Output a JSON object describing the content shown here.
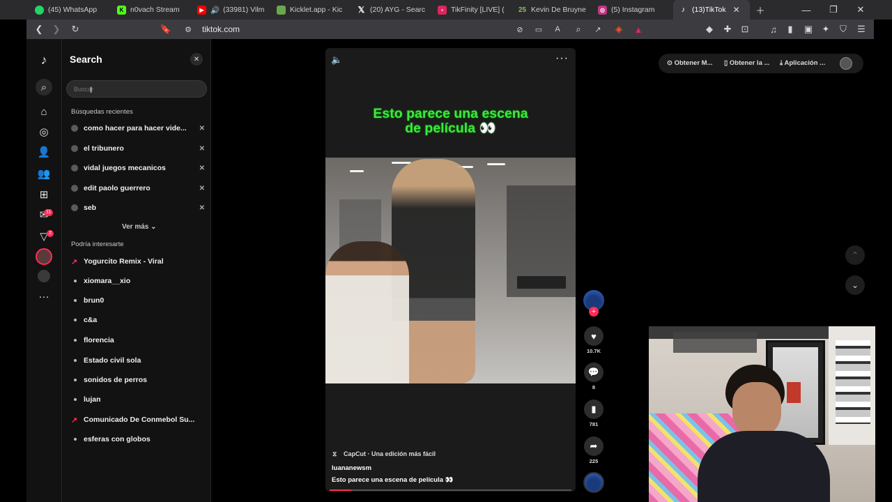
{
  "tabs": [
    {
      "title": "(45) WhatsApp",
      "color": "#25d366"
    },
    {
      "title": "n0vach Stream",
      "color": "#53fc18"
    },
    {
      "title": "(33981) Vilm",
      "color": "#ff0000"
    },
    {
      "title": "Kicklet.app - Kic",
      "color": "#6aa84f"
    },
    {
      "title": "(20) AYG - Searc",
      "color": "#000000"
    },
    {
      "title": "TikFinity [LIVE] (",
      "color": "#e0245e"
    },
    {
      "title": "Kevin De Bruyne",
      "color": "#8bc34a"
    },
    {
      "title": "(5) Instagram",
      "color": "#c13584"
    },
    {
      "title": "(13)TikTok",
      "color": "#000000"
    }
  ],
  "browser": {
    "url": "tiktok.com"
  },
  "search_panel": {
    "title": "Search",
    "input_value": "",
    "input_placeholder": "Buscar",
    "recent_label": "Búsquedas recientes",
    "recent": [
      "como hacer para hacer vide...",
      "el tribunero",
      "vidal juegos mecanicos",
      "edit paolo guerrero",
      "seb"
    ],
    "see_more": "Ver más",
    "suggest_label": "Podría interesarte",
    "suggestions": [
      {
        "text": "Yogurcito Remix - Viral",
        "trending": true
      },
      {
        "text": "xiomara__xio",
        "trending": false
      },
      {
        "text": "brun0",
        "trending": false
      },
      {
        "text": "c&a",
        "trending": false
      },
      {
        "text": "florencia",
        "trending": false
      },
      {
        "text": "Estado civil sola",
        "trending": false
      },
      {
        "text": "sonidos de perros",
        "trending": false
      },
      {
        "text": "lujan",
        "trending": false
      },
      {
        "text": "Comunicado De Conmebol Su...",
        "trending": true
      },
      {
        "text": "esferas con globos",
        "trending": false
      }
    ]
  },
  "rail_badges": {
    "inbox": "11",
    "activity": "2"
  },
  "video": {
    "caption_line1": "Esto parece una escena",
    "caption_line2": "de película 👀",
    "source": "CapCut · Una edición más fácil",
    "author": "luananewsm",
    "description": "Esto parece una escena de película 👀",
    "progress": 0.09
  },
  "actions": {
    "likes": "10.7K",
    "comments": "8",
    "saves": "781",
    "shares": "225"
  },
  "top_right": {
    "item1": "Obtener M...",
    "item2": "Obtener la ...",
    "item3": "Aplicación ..."
  },
  "colors": {
    "accent": "#fe2c55",
    "caption": "#3ee83e"
  }
}
